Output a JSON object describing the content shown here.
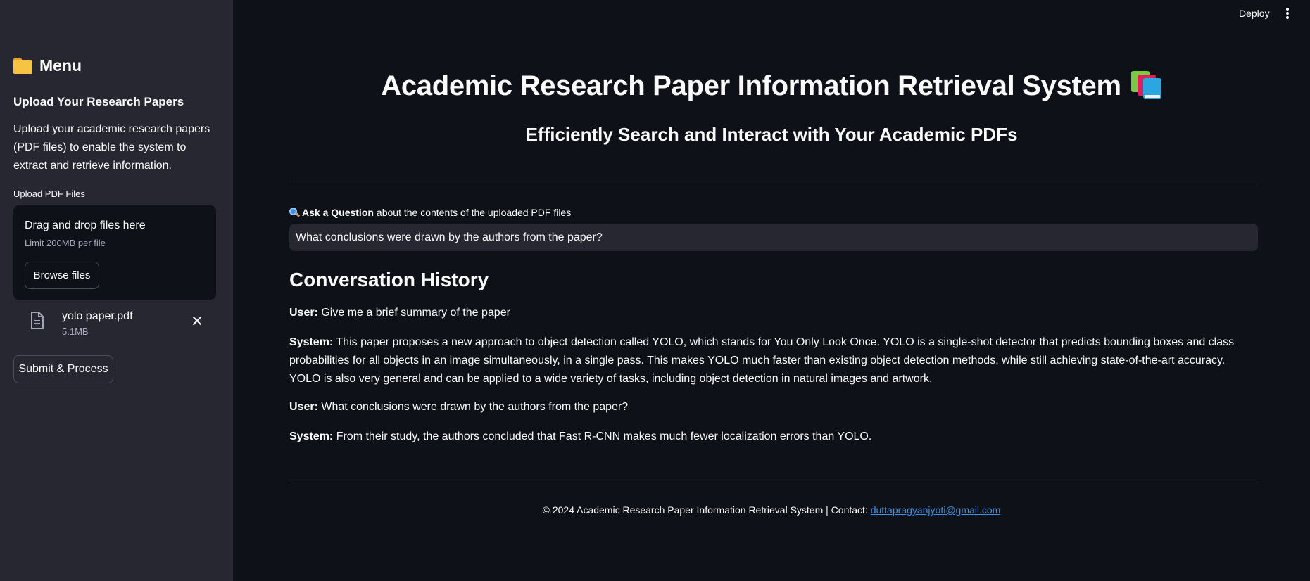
{
  "sidebar": {
    "title": "Menu",
    "title_icon": "folder-icon",
    "section_heading": "Upload Your Research Papers",
    "description": "Upload your academic research papers (PDF files) to enable the system to extract and retrieve information.",
    "uploader": {
      "label": "Upload PDF Files",
      "drop_text": "Drag and drop files here",
      "limit_text": "Limit 200MB per file",
      "browse_label": "Browse files",
      "file": {
        "name": "yolo paper.pdf",
        "size": "5.1MB"
      }
    },
    "submit_label": "Submit & Process"
  },
  "header": {
    "deploy_label": "Deploy"
  },
  "main": {
    "title": "Academic Research Paper Information Retrieval System",
    "title_icon": "books-icon",
    "subtitle": "Efficiently Search and Interact with Your Academic PDFs",
    "ask": {
      "icon": "search-icon",
      "label_bold": "Ask a Question",
      "label_rest": "about the contents of the uploaded PDF files",
      "input_value": "What conclusions were drawn by the authors from the paper?"
    },
    "history": {
      "title": "Conversation History",
      "messages": [
        {
          "role": "User:",
          "text": "Give me a brief summary of the paper"
        },
        {
          "role": "System:",
          "text": "This paper proposes a new approach to object detection called YOLO, which stands for You Only Look Once. YOLO is a single-shot detector that predicts bounding boxes and class probabilities for all objects in an image simultaneously, in a single pass. This makes YOLO much faster than existing object detection methods, while still achieving state-of-the-art accuracy. YOLO is also very general and can be applied to a wide variety of tasks, including object detection in natural images and artwork."
        },
        {
          "role": "User:",
          "text": "What conclusions were drawn by the authors from the paper?"
        },
        {
          "role": "System:",
          "text": "From their study, the authors concluded that Fast R-CNN makes much fewer localization errors than YOLO."
        }
      ]
    }
  },
  "footer": {
    "text": "© 2024 Academic Research Paper Information Retrieval System | Contact:",
    "email": "duttapragyanjyoti@gmail.com"
  },
  "colors": {
    "app_bg": "#0e1117",
    "sidebar_bg": "#262730",
    "input_bg": "#262730",
    "link": "#3d8fe0"
  }
}
